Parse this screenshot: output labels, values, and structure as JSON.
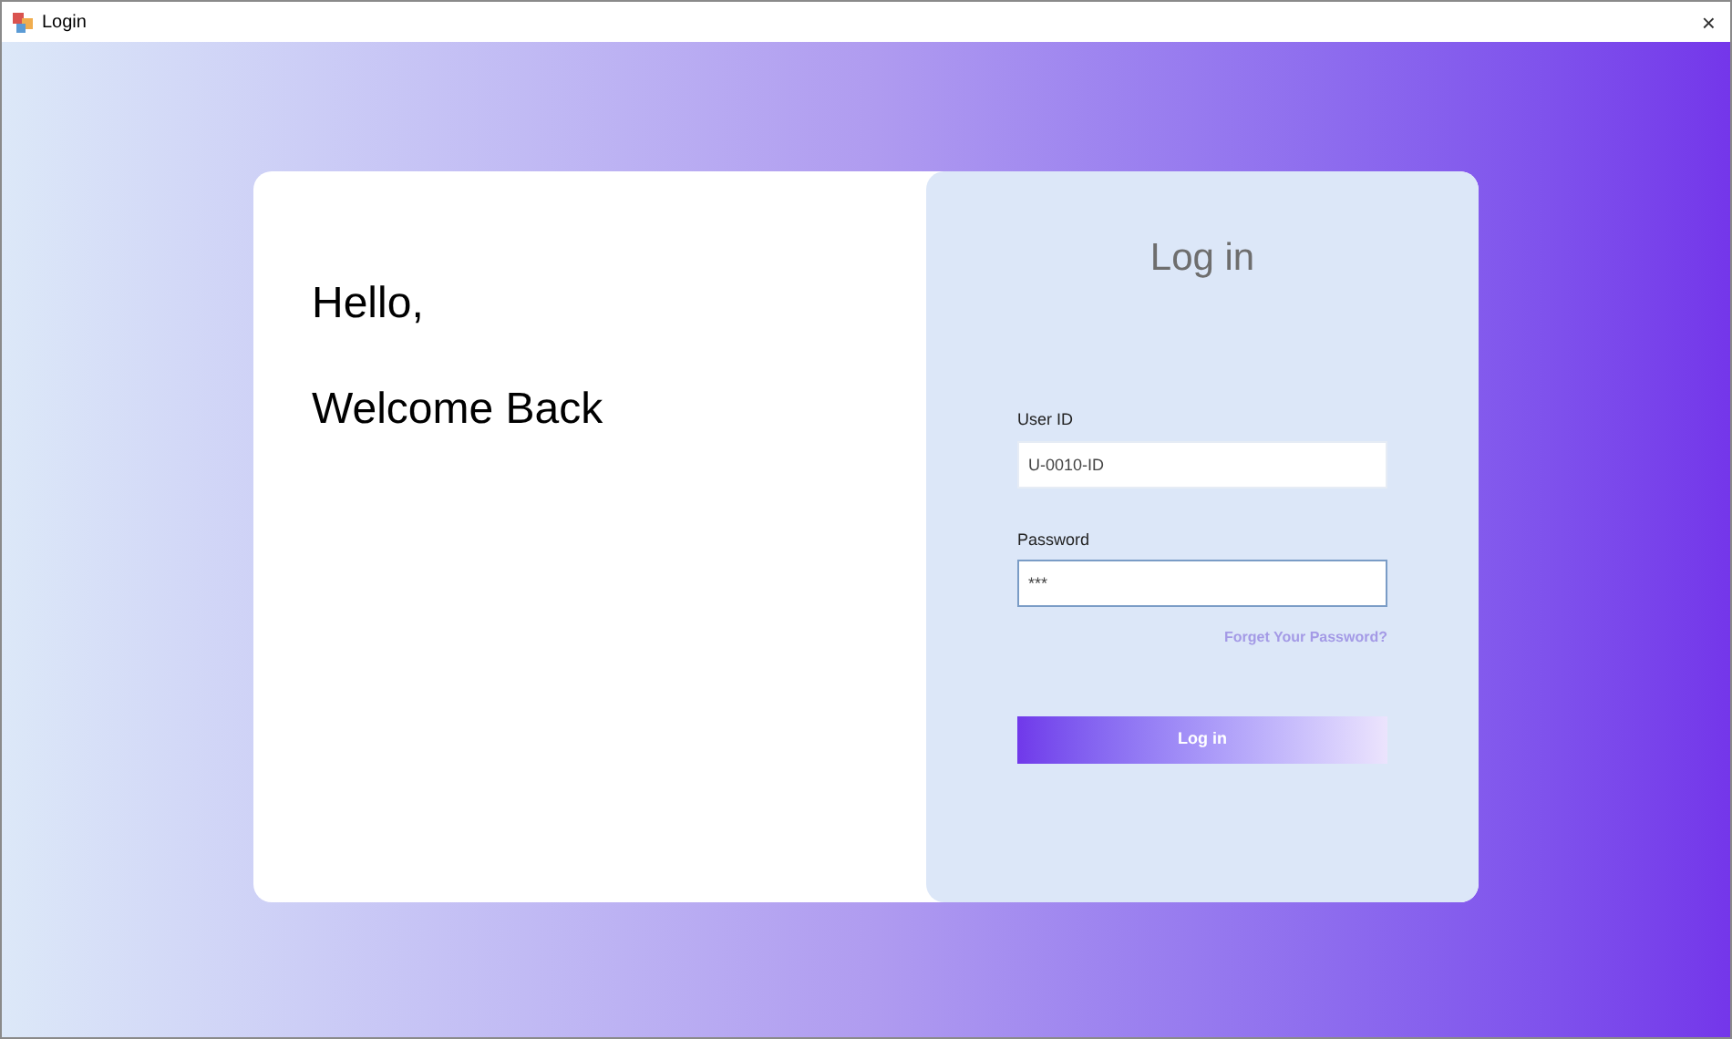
{
  "window": {
    "title": "Login",
    "close": "×"
  },
  "greeting": {
    "line_1": "Hello,",
    "line_2": "Welcome Back"
  },
  "form": {
    "title": "Log in",
    "fields": [
      {
        "label": "User ID",
        "value": "U-0010-ID",
        "focused": false
      },
      {
        "label": "Password",
        "value": "***",
        "focused": true
      }
    ],
    "forgot_link": "Forget Your Password?",
    "submit": "Log in"
  }
}
